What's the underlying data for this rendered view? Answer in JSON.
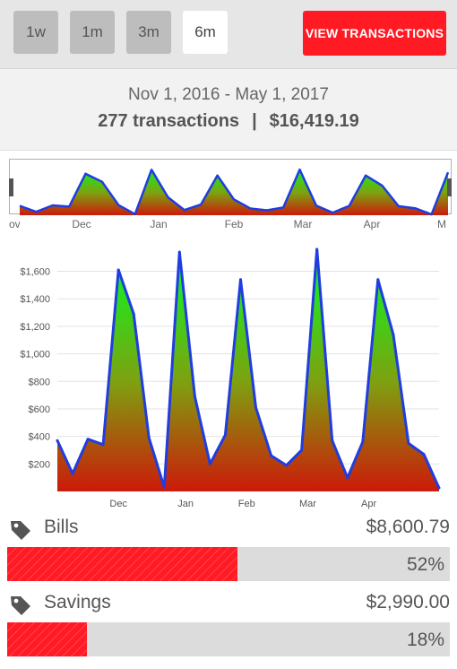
{
  "toolbar": {
    "ranges": [
      "1w",
      "1m",
      "3m",
      "6m"
    ],
    "active_range": "6m",
    "view_button_label": "VIEW TRANSACTIONS",
    "colors": {
      "button_bg": "#bdbdbd",
      "active_bg": "#ffffff",
      "accent": "#ff1a24"
    }
  },
  "summary": {
    "date_range": "Nov 1, 2016 - May 1, 2017",
    "transaction_count": "277 transactions",
    "separator": "|",
    "total": "$16,419.19"
  },
  "chart_data": [
    {
      "type": "area",
      "role": "overview",
      "x_tick_labels": [
        "ov",
        "Dec",
        "Jan",
        "Feb",
        "Mar",
        "Apr",
        "M"
      ],
      "values": [
        360,
        130,
        380,
        330,
        1600,
        1290,
        390,
        40,
        1750,
        690,
        200,
        410,
        1530,
        610,
        260,
        190,
        300,
        1760,
        370,
        100,
        360,
        1530,
        1140,
        350,
        270,
        30,
        1650
      ],
      "ylim": [
        0,
        1900
      ],
      "colors": {
        "line": "#1f3de0",
        "fill_top": "#00ff22",
        "fill_bottom": "#cc1a0a"
      }
    },
    {
      "type": "area",
      "role": "main",
      "x": [
        "Nov 1",
        "Nov 8",
        "Nov 15",
        "Nov 22",
        "Nov 29",
        "Dec 6",
        "Dec 13",
        "Dec 20",
        "Dec 27",
        "Jan 3",
        "Jan 10",
        "Jan 17",
        "Jan 24",
        "Jan 31",
        "Feb 7",
        "Feb 14",
        "Feb 21",
        "Feb 28",
        "Mar 7",
        "Mar 14",
        "Mar 21",
        "Mar 28",
        "Apr 4",
        "Apr 11",
        "Apr 18",
        "Apr 25"
      ],
      "values": [
        370,
        130,
        380,
        340,
        1610,
        1290,
        390,
        30,
        1740,
        690,
        200,
        410,
        1540,
        610,
        260,
        190,
        300,
        1760,
        370,
        100,
        360,
        1540,
        1140,
        350,
        270,
        25
      ],
      "x_tick_labels": [
        {
          "label": "Dec",
          "pos": 4
        },
        {
          "label": "Jan",
          "pos": 8.4
        },
        {
          "label": "Feb",
          "pos": 12.4
        },
        {
          "label": "Mar",
          "pos": 16.4
        },
        {
          "label": "Apr",
          "pos": 20.4
        }
      ],
      "y_ticks": [
        200,
        400,
        600,
        800,
        1000,
        1200,
        1400,
        1600
      ],
      "y_tick_labels": [
        "$200",
        "$400",
        "$600",
        "$800",
        "$1,000",
        "$1,200",
        "$1,400",
        "$1,600"
      ],
      "ylim": [
        0,
        1760
      ],
      "grid": true,
      "colors": {
        "line": "#1f3de0",
        "fill_top": "#00ff22",
        "fill_bottom": "#cc1a0a",
        "grid": "#e3e3e3"
      }
    }
  ],
  "categories": [
    {
      "name": "Bills",
      "amount": "$8,600.79",
      "percent_label": "52%",
      "percent": 52,
      "icon": "tag-icon"
    },
    {
      "name": "Savings",
      "amount": "$2,990.00",
      "percent_label": "18%",
      "percent": 18,
      "icon": "tag-icon"
    }
  ]
}
